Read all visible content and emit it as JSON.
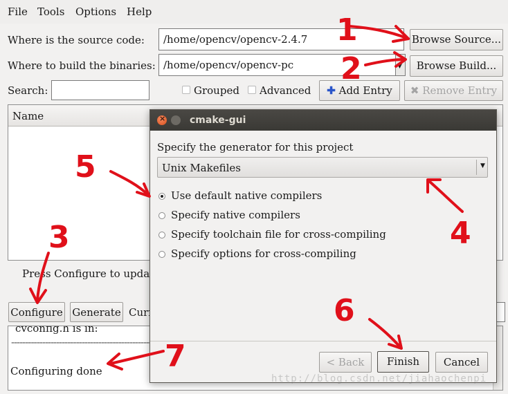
{
  "menubar": {
    "items": [
      "File",
      "Tools",
      "Options",
      "Help"
    ]
  },
  "source": {
    "label": "Where is the source code:",
    "value": "/home/opencv/opencv-2.4.7",
    "browse_label": "Browse Source..."
  },
  "build": {
    "label": "Where to build the binaries:",
    "value": "/home/opencv/opencv-pc",
    "browse_label": "Browse Build..."
  },
  "search": {
    "label": "Search:",
    "value": ""
  },
  "options": {
    "grouped_label": "Grouped",
    "advanced_label": "Advanced",
    "add_entry_label": "Add Entry",
    "remove_entry_label": "Remove Entry"
  },
  "table": {
    "header_name": "Name"
  },
  "status": {
    "press_configure": "Press Configure to upda"
  },
  "actions": {
    "configure_label": "Configure",
    "generate_label": "Generate",
    "current_label": "Curr"
  },
  "log": {
    "line_partial": "cvconfig.h is in:",
    "separator": "--------------------------------------------------",
    "done": "Configuring done"
  },
  "dialog": {
    "title": "cmake-gui",
    "prompt": "Specify the generator for this project",
    "generator": "Unix Makefiles",
    "radios": [
      {
        "label": "Use default native compilers",
        "selected": true
      },
      {
        "label": "Specify native compilers",
        "selected": false
      },
      {
        "label": "Specify toolchain file for cross-compiling",
        "selected": false
      },
      {
        "label": "Specify options for cross-compiling",
        "selected": false
      }
    ],
    "back_label": "< Back",
    "finish_label": "Finish",
    "cancel_label": "Cancel"
  },
  "annotations": {
    "color": "#e0101a",
    "numbers": [
      "1",
      "2",
      "3",
      "4",
      "5",
      "6",
      "7"
    ]
  },
  "watermark": "http://blog.csdn.net/jiahaochenpi"
}
